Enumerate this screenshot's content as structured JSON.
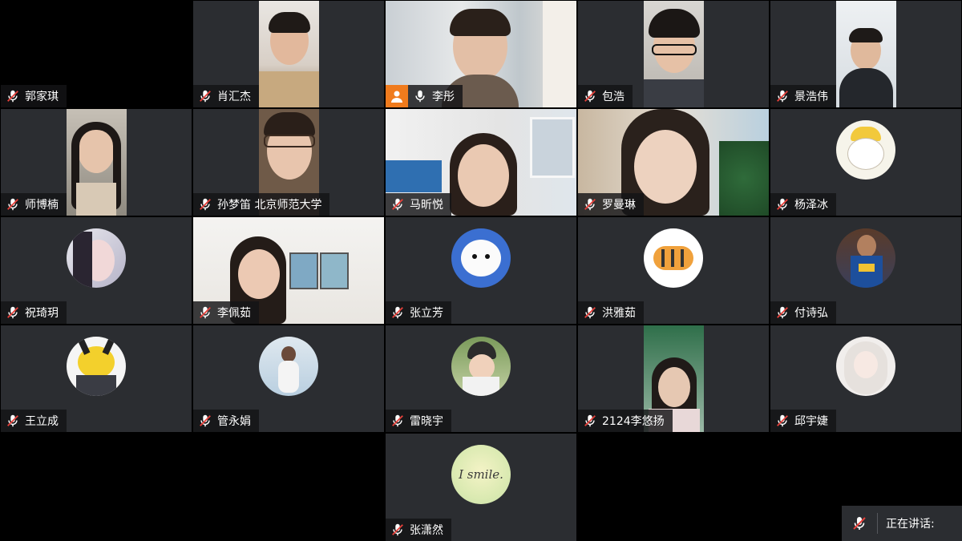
{
  "participants": [
    {
      "name": "郭家琪"
    },
    {
      "name": "肖汇杰"
    },
    {
      "name": "李彤"
    },
    {
      "name": "包浩"
    },
    {
      "name": "景浩伟"
    },
    {
      "name": "师博楠"
    },
    {
      "name": "孙梦笛 北京师范大学"
    },
    {
      "name": "马昕悦"
    },
    {
      "name": "罗曼琳"
    },
    {
      "name": "杨泽冰"
    },
    {
      "name": "祝琦玥"
    },
    {
      "name": "李佩茹"
    },
    {
      "name": "张立芳"
    },
    {
      "name": "洪雅茹"
    },
    {
      "name": "付诗弘"
    },
    {
      "name": "王立成"
    },
    {
      "name": "管永娟"
    },
    {
      "name": "雷晓宇"
    },
    {
      "name": "2124李悠扬"
    },
    {
      "name": "邱宇婕"
    },
    {
      "name": "张潇然",
      "avatar_text": "I smile."
    }
  ],
  "speaking_bar": {
    "label": "正在讲话:"
  },
  "colors": {
    "tile_bg": "#2b2d31",
    "host_badge": "#f07b1d",
    "muted_mic": "#ffffff"
  }
}
